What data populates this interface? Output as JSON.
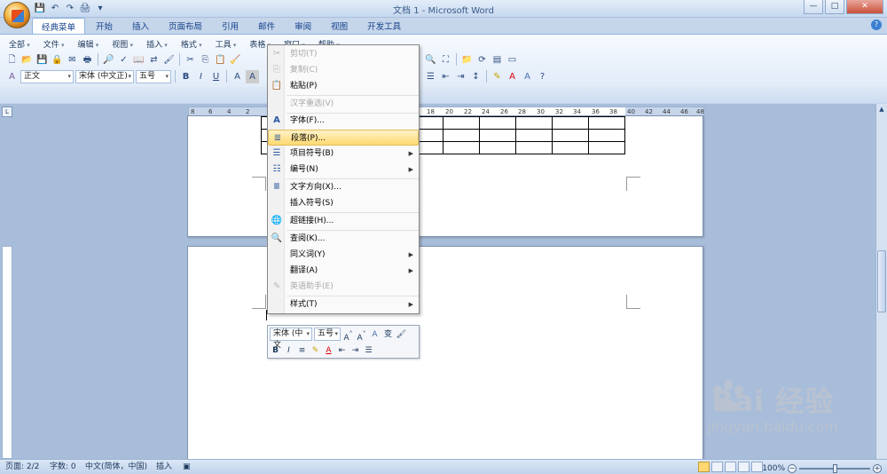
{
  "window": {
    "title": "文档 1 - Microsoft Word",
    "min": "—",
    "max": "□",
    "close": "✕"
  },
  "qat": [
    "💾",
    "↶",
    "↷",
    "🖨",
    "▾"
  ],
  "tabs": [
    "经典菜单",
    "开始",
    "插入",
    "页面布局",
    "引用",
    "邮件",
    "审阅",
    "视图",
    "开发工具"
  ],
  "menus": [
    "全部",
    "文件",
    "编辑",
    "视图",
    "插入",
    "格式",
    "工具",
    "表格",
    "窗口",
    "帮助"
  ],
  "toolbar": {
    "style": "正文",
    "font": "宋体 (中文正)",
    "size": "五号",
    "bold": "B",
    "italic": "I",
    "underline": "U"
  },
  "ruler": [
    "8",
    "6",
    "4",
    "2",
    "",
    "2",
    "4",
    "6",
    "8",
    "10",
    "12",
    "14",
    "16",
    "18",
    "20",
    "22",
    "24",
    "26",
    "28",
    "30",
    "32",
    "34",
    "36",
    "38",
    "40",
    "42",
    "44",
    "46",
    "48"
  ],
  "context_menu": [
    {
      "icon": "✂",
      "label": "剪切(T)",
      "disabled": true
    },
    {
      "icon": "⎘",
      "label": "复制(C)",
      "disabled": true
    },
    {
      "icon": "📋",
      "label": "粘贴(P)",
      "disabled": false
    },
    {
      "sep": true
    },
    {
      "icon": "",
      "label": "汉字重选(V)",
      "disabled": true
    },
    {
      "sep": true
    },
    {
      "icon": "A",
      "label": "字体(F)...",
      "disabled": false
    },
    {
      "icon": "≣",
      "label": "段落(P)...",
      "disabled": false,
      "highlight": true
    },
    {
      "icon": "☰",
      "label": "项目符号(B)",
      "disabled": false,
      "submenu": true
    },
    {
      "icon": "☷",
      "label": "编号(N)",
      "disabled": false,
      "submenu": true
    },
    {
      "sep": true
    },
    {
      "icon": "Ⅲ",
      "label": "文字方向(X)...",
      "disabled": false
    },
    {
      "icon": "",
      "label": "插入符号(S)",
      "disabled": false
    },
    {
      "sep": true
    },
    {
      "icon": "🌐",
      "label": "超链接(H)...",
      "disabled": false
    },
    {
      "sep": true
    },
    {
      "icon": "🔍",
      "label": "查阅(K)...",
      "disabled": false
    },
    {
      "icon": "",
      "label": "同义词(Y)",
      "disabled": false,
      "submenu": true
    },
    {
      "icon": "",
      "label": "翻译(A)",
      "disabled": false,
      "submenu": true
    },
    {
      "icon": "✎",
      "label": "英语助手(E)",
      "disabled": true
    },
    {
      "sep": true
    },
    {
      "icon": "",
      "label": "样式(T)",
      "disabled": false,
      "submenu": true
    }
  ],
  "mini_toolbar": {
    "font": "宋体 (中文",
    "size": "五号"
  },
  "status": {
    "page": "页面: 2/2",
    "words": "字数: 0",
    "lang": "中文(简体，中国)",
    "mode": "插入",
    "zoom": "100%"
  },
  "watermark": {
    "brand": "Bai  经验",
    "url": "jingyan.baidu.com"
  },
  "colors": {
    "accent": "#15428b",
    "highlight": "#ffd970"
  }
}
